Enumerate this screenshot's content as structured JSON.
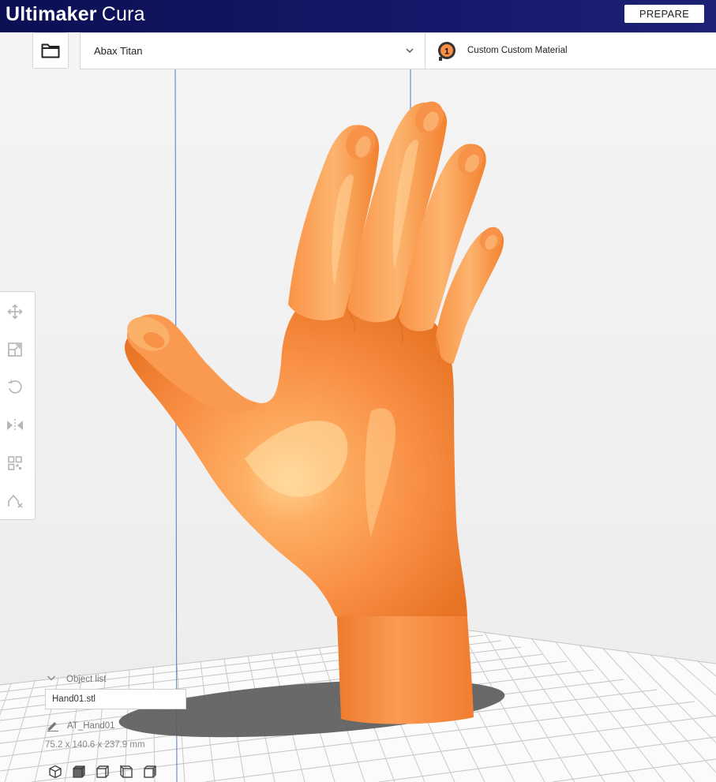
{
  "header": {
    "brand_bold": "Ultimaker",
    "brand_light": "Cura",
    "stage_button": "PREPARE",
    "bar_color": "#10135f"
  },
  "printer": {
    "name": "Abax Titan",
    "extruder_number": "1",
    "material": "Custom Custom Material"
  },
  "toolbar": {
    "tools": [
      "move-icon",
      "scale-icon",
      "rotate-icon",
      "mirror-icon",
      "per-model-settings-icon",
      "support-blocker-icon"
    ]
  },
  "object_panel": {
    "title": "Object list",
    "items": [
      "Hand01.stl"
    ],
    "object_name": "AT_Hand01",
    "dimensions": "75.2 x 140.6 x 237.9 mm",
    "view_buttons": [
      "3d-view-icon",
      "front-view-icon",
      "top-view-icon",
      "left-view-icon",
      "right-view-icon"
    ]
  },
  "model": {
    "color": "#f98f45",
    "shadow_color": "#5c5c5c"
  }
}
